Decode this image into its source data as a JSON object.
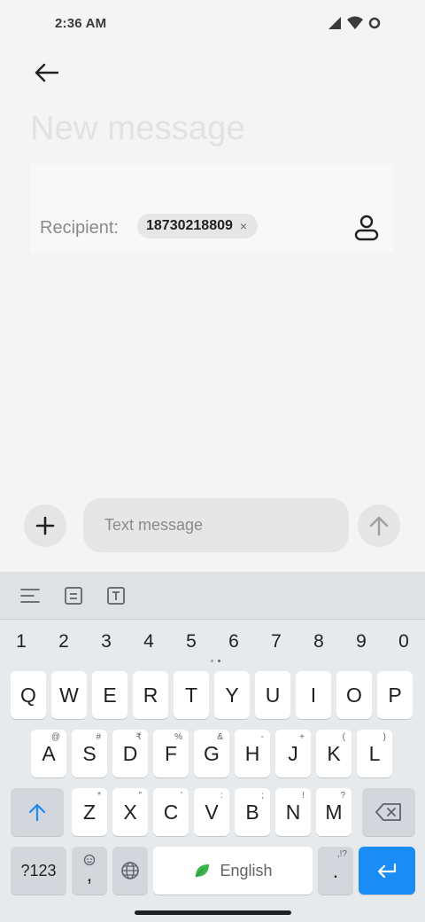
{
  "status_bar": {
    "time": "2:36 AM"
  },
  "header": {
    "title": "New message"
  },
  "recipient": {
    "label": "Recipient:",
    "chip": "18730218809",
    "chip_close": "×"
  },
  "compose": {
    "placeholder": "Text message"
  },
  "keyboard": {
    "numbers": [
      "1",
      "2",
      "3",
      "4",
      "5",
      "6",
      "7",
      "8",
      "9",
      "0"
    ],
    "row1": [
      {
        "k": "Q",
        "h": ""
      },
      {
        "k": "W",
        "h": ""
      },
      {
        "k": "E",
        "h": ""
      },
      {
        "k": "R",
        "h": ""
      },
      {
        "k": "T",
        "h": ""
      },
      {
        "k": "Y",
        "h": ""
      },
      {
        "k": "U",
        "h": ""
      },
      {
        "k": "I",
        "h": ""
      },
      {
        "k": "O",
        "h": ""
      },
      {
        "k": "P",
        "h": ""
      }
    ],
    "row2": [
      {
        "k": "A",
        "h": "@"
      },
      {
        "k": "S",
        "h": "#"
      },
      {
        "k": "D",
        "h": "₹"
      },
      {
        "k": "F",
        "h": "%"
      },
      {
        "k": "G",
        "h": "&"
      },
      {
        "k": "H",
        "h": "-"
      },
      {
        "k": "J",
        "h": "+"
      },
      {
        "k": "K",
        "h": "("
      },
      {
        "k": "L",
        "h": ")"
      }
    ],
    "row3": [
      {
        "k": "Z",
        "h": "*"
      },
      {
        "k": "X",
        "h": "\""
      },
      {
        "k": "C",
        "h": "'"
      },
      {
        "k": "V",
        "h": ":"
      },
      {
        "k": "B",
        "h": ";"
      },
      {
        "k": "N",
        "h": "!"
      },
      {
        "k": "M",
        "h": "?"
      }
    ],
    "symbols_label": "?123",
    "comma_label": ",",
    "space_label": "English",
    "period_label": ".",
    "period_hint": ",!?"
  },
  "colors": {
    "accent": "#1a8cf5",
    "background": "#f4f4f4",
    "keyboard": "#e7eaed"
  }
}
